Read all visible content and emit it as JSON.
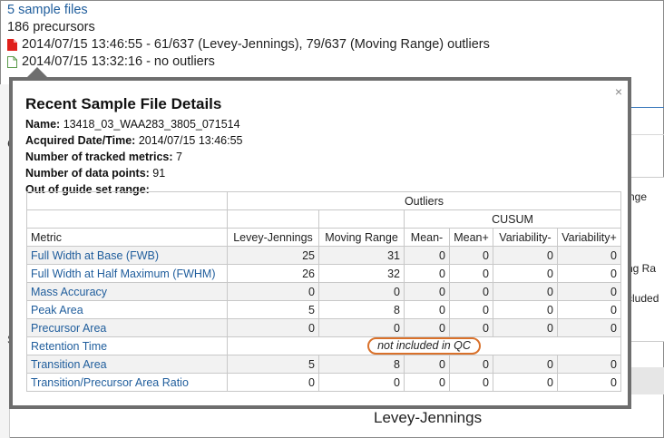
{
  "background": {
    "sample_files_link": "5 sample files",
    "precursors": "186 precursors",
    "files": [
      {
        "icon": "red-file-icon",
        "text": "2014/07/15 13:46:55 - 61/637 (Levey-Jennings), 79/637 (Moving Range) outliers"
      },
      {
        "icon": "white-file-icon",
        "text": "2014/07/15 13:32:16 - no outliers"
      }
    ],
    "side_labels": [
      "nge",
      "ng Ra",
      "cluded"
    ],
    "left_letters": [
      "C",
      "S"
    ],
    "bottom_chart_title": "Levey-Jennings"
  },
  "popup": {
    "title": "Recent Sample File Details",
    "close_glyph": "×",
    "details": [
      {
        "label": "Name:",
        "value": "13418_03_WAA283_3805_071514"
      },
      {
        "label": "Acquired Date/Time:",
        "value": "2014/07/15 13:46:55"
      },
      {
        "label": "Number of tracked metrics:",
        "value": "7"
      },
      {
        "label": "Number of data points:",
        "value": "91"
      },
      {
        "label": "Out of guide set range:",
        "value": ""
      }
    ],
    "table": {
      "group_header": "Outliers",
      "cusum_header": "CUSUM",
      "columns": [
        "Metric",
        "Levey-Jennings",
        "Moving Range",
        "Mean-",
        "Mean+",
        "Variability-",
        "Variability+"
      ],
      "rows": [
        {
          "metric": "Full Width at Base (FWB)",
          "values": [
            "25",
            "31",
            "0",
            "0",
            "0",
            "0"
          ]
        },
        {
          "metric": "Full Width at Half Maximum (FWHM)",
          "values": [
            "26",
            "32",
            "0",
            "0",
            "0",
            "0"
          ]
        },
        {
          "metric": "Mass Accuracy",
          "values": [
            "0",
            "0",
            "0",
            "0",
            "0",
            "0"
          ]
        },
        {
          "metric": "Peak Area",
          "values": [
            "5",
            "8",
            "0",
            "0",
            "0",
            "0"
          ]
        },
        {
          "metric": "Precursor Area",
          "values": [
            "0",
            "0",
            "0",
            "0",
            "0",
            "0"
          ]
        },
        {
          "metric": "Retention Time",
          "note": "not included in QC"
        },
        {
          "metric": "Transition Area",
          "values": [
            "5",
            "8",
            "0",
            "0",
            "0",
            "0"
          ]
        },
        {
          "metric": "Transition/Precursor Area Ratio",
          "values": [
            "0",
            "0",
            "0",
            "0",
            "0",
            "0"
          ]
        }
      ]
    }
  }
}
